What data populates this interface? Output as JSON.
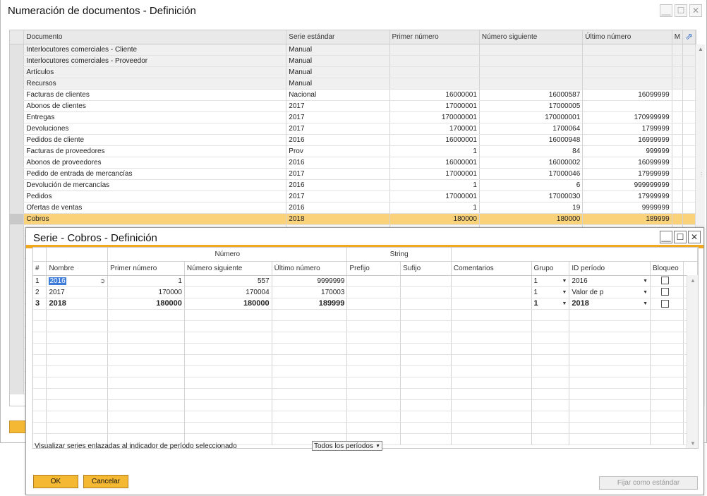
{
  "window": {
    "title": "Numeración de documentos - Definición",
    "controls": {
      "minimize": "__",
      "maximize": "☐",
      "close": "✕"
    }
  },
  "outer_table": {
    "columns": [
      "Documento",
      "Serie estándar",
      "Primer número",
      "Número siguiente",
      "Último número",
      "M"
    ],
    "rows": [
      {
        "doc": "Interlocutores comerciales - Cliente",
        "serie": "Manual",
        "primer": "",
        "siguiente": "",
        "ultimo": ""
      },
      {
        "doc": "Interlocutores comerciales - Proveedor",
        "serie": "Manual",
        "primer": "",
        "siguiente": "",
        "ultimo": ""
      },
      {
        "doc": "Artículos",
        "serie": "Manual",
        "primer": "",
        "siguiente": "",
        "ultimo": ""
      },
      {
        "doc": "Recursos",
        "serie": "Manual",
        "primer": "",
        "siguiente": "",
        "ultimo": ""
      },
      {
        "doc": "Facturas de clientes",
        "serie": "Nacional",
        "primer": "16000001",
        "siguiente": "16000587",
        "ultimo": "16099999"
      },
      {
        "doc": "Abonos de clientes",
        "serie": "2017",
        "primer": "17000001",
        "siguiente": "17000005",
        "ultimo": ""
      },
      {
        "doc": "Entregas",
        "serie": "2017",
        "primer": "170000001",
        "siguiente": "170000001",
        "ultimo": "170999999"
      },
      {
        "doc": "Devoluciones",
        "serie": "2017",
        "primer": "1700001",
        "siguiente": "1700064",
        "ultimo": "1799999"
      },
      {
        "doc": "Pedidos de cliente",
        "serie": "2016",
        "primer": "16000001",
        "siguiente": "16000948",
        "ultimo": "16999999"
      },
      {
        "doc": "Facturas de proveedores",
        "serie": "Prov",
        "primer": "1",
        "siguiente": "84",
        "ultimo": "999999"
      },
      {
        "doc": "Abonos de proveedores",
        "serie": "2016",
        "primer": "16000001",
        "siguiente": "16000002",
        "ultimo": "16099999"
      },
      {
        "doc": "Pedido de entrada de mercancías",
        "serie": "2017",
        "primer": "17000001",
        "siguiente": "17000046",
        "ultimo": "17999999"
      },
      {
        "doc": "Devolución de mercancías",
        "serie": "2016",
        "primer": "1",
        "siguiente": "6",
        "ultimo": "999999999"
      },
      {
        "doc": "Pedidos",
        "serie": "2017",
        "primer": "17000001",
        "siguiente": "17000030",
        "ultimo": "17999999"
      },
      {
        "doc": "Ofertas de ventas",
        "serie": "2016",
        "primer": "1",
        "siguiente": "19",
        "ultimo": "9999999"
      },
      {
        "doc": "Cobros",
        "serie": "2018",
        "primer": "180000",
        "siguiente": "180000",
        "ultimo": "189999"
      }
    ]
  },
  "dialog": {
    "title": "Serie - Cobros - Definición",
    "controls": {
      "minimize": "__",
      "maximize": "☐",
      "close": "✕"
    },
    "group_headers": {
      "numero": "Número",
      "string": "String"
    },
    "columns": [
      "#",
      "Nombre",
      "Primer número",
      "Número siguiente",
      "Último número",
      "Prefijo",
      "Sufijo",
      "Comentarios",
      "Grupo",
      "ID período",
      "Bloqueo"
    ],
    "rows": [
      {
        "n": "1",
        "nombre": "2016",
        "primer": "1",
        "siguiente": "557",
        "ultimo": "9999999",
        "prefijo": "",
        "sufijo": "",
        "comentarios": "",
        "grupo": "1",
        "periodo": "2016",
        "bloqueo": false
      },
      {
        "n": "2",
        "nombre": "2017",
        "primer": "170000",
        "siguiente": "170004",
        "ultimo": "170003",
        "prefijo": "",
        "sufijo": "",
        "comentarios": "",
        "grupo": "1",
        "periodo": "Valor de p",
        "bloqueo": false
      },
      {
        "n": "3",
        "nombre": "2018",
        "primer": "180000",
        "siguiente": "180000",
        "ultimo": "189999",
        "prefijo": "",
        "sufijo": "",
        "comentarios": "",
        "grupo": "1",
        "periodo": "2018",
        "bloqueo": false
      }
    ],
    "link_label": "Visualizar series enlazadas al indicador de período seleccionado",
    "period_filter": "Todos los períodos",
    "buttons": {
      "ok": "OK",
      "cancel": "Cancelar",
      "set_default": "Fijar como estándar"
    }
  },
  "colors": {
    "accent": "#f0a81e",
    "button": "#f5b833",
    "selected_row": "#fad27a"
  },
  "icons": {
    "expand": "expand-arrow-icon",
    "dropdown": "dropdown-arrow-icon",
    "link": "link-arrow-icon"
  }
}
